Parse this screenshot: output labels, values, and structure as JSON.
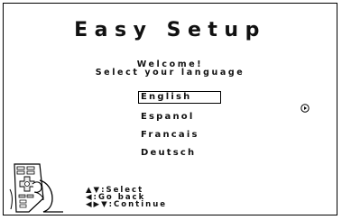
{
  "screen": {
    "title": "Easy Setup",
    "welcome": "Welcome!",
    "prompt": "Select your language"
  },
  "languages": [
    {
      "label": "English",
      "selected": true
    },
    {
      "label": "Espanol",
      "selected": false
    },
    {
      "label": "Francais",
      "selected": false
    },
    {
      "label": "Deutsch",
      "selected": false
    }
  ],
  "icons": {
    "next": "play-circle-icon",
    "remote": "remote-control-illustration"
  },
  "help": [
    {
      "keys": "▲▼",
      "text": "Select"
    },
    {
      "keys": "◀",
      "text": "Go back"
    },
    {
      "keys": "◀▶▼",
      "text": "Continue"
    }
  ],
  "colors": {
    "background": "#ffffff",
    "foreground": "#111111"
  }
}
